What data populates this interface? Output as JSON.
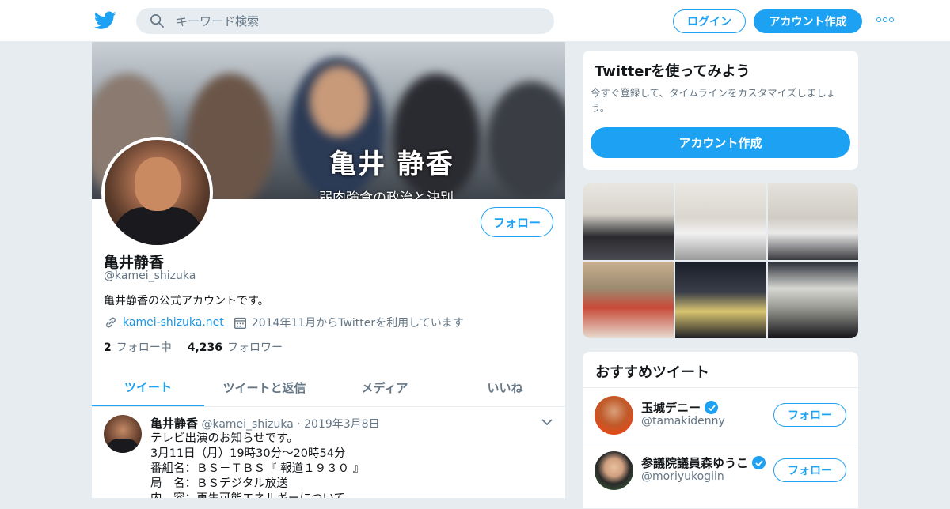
{
  "header": {
    "search_placeholder": "キーワード検索",
    "login_label": "ログイン",
    "signup_label": "アカウント作成"
  },
  "profile": {
    "banner_title": "亀井 静香",
    "banner_subtitle": "弱肉強食の政治と決別",
    "follow_label": "フォロー",
    "name": "亀井静香",
    "handle": "@kamei_shizuka",
    "bio": "亀井静香の公式アカウントです。",
    "website": "kamei-shizuka.net",
    "joined": "2014年11月からTwitterを利用しています",
    "following_count": "2",
    "following_label": "フォロー中",
    "followers_count": "4,236",
    "followers_label": "フォロワー"
  },
  "tabs": [
    {
      "label": "ツイート",
      "active": true
    },
    {
      "label": "ツイートと返信"
    },
    {
      "label": "メディア"
    },
    {
      "label": "いいね"
    }
  ],
  "tweet": {
    "name": "亀井静香",
    "handle": "@kamei_shizuka",
    "date": "2019年3月8日",
    "body": "テレビ出演のお知らせです。\n3月11日（月）19時30分～20時54分\n番組名：ＢＳ－ＴＢＳ『 報道１９３０ 』\n局　名：ＢＳデジタル放送\n内　容：再生可能エネルギーについて"
  },
  "sidebar": {
    "try_title": "Twitterを使ってみよう",
    "try_text": "今すぐ登録して、タイムラインをカスタマイズしましょう。",
    "try_button": "アカウント作成",
    "recommended_title": "おすすめツイート",
    "recommended": [
      {
        "name": "玉城デニー",
        "handle": "@tamakidenny",
        "follow": "フォロー",
        "verified": true
      },
      {
        "name": "参議院議員森ゆうこ",
        "handle": "@moriyukogiin",
        "follow": "フォロー",
        "verified": true
      }
    ]
  },
  "colors": {
    "accent": "#1da1f2",
    "background": "#e6ecf0",
    "secondary_text": "#657786"
  }
}
